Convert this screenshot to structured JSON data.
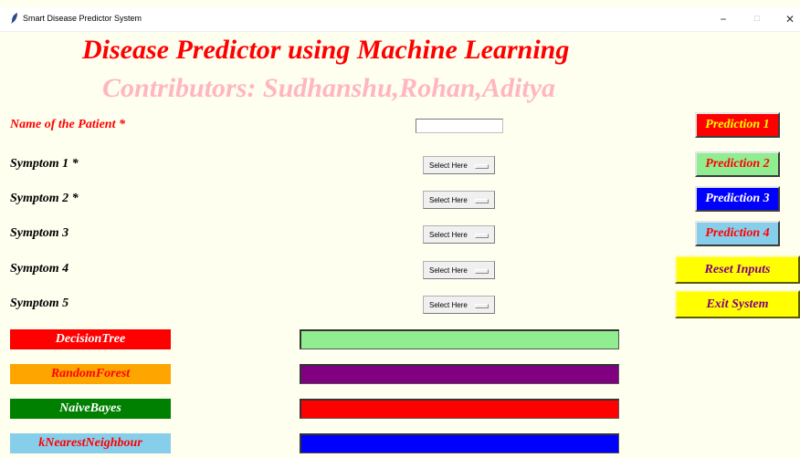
{
  "window": {
    "title": "Smart Disease Predictor System",
    "controls": {
      "minimize": "−",
      "maximize": "□",
      "close": "✕"
    }
  },
  "header": {
    "title": "Disease Predictor using Machine Learning",
    "subtitle": "Contributors: Sudhanshu,Rohan,Aditya"
  },
  "form": {
    "name_label": "Name of the Patient *",
    "name_value": "",
    "symptoms": [
      {
        "label": "Symptom 1 *",
        "selected": "Select Here"
      },
      {
        "label": "Symptom 2 *",
        "selected": "Select Here"
      },
      {
        "label": "Symptom 3",
        "selected": "Select Here"
      },
      {
        "label": "Symptom 4",
        "selected": "Select Here"
      },
      {
        "label": "Symptom 5",
        "selected": "Select Here"
      }
    ]
  },
  "buttons": {
    "prediction_1": "Prediction 1",
    "prediction_2": "Prediction 2",
    "prediction_3": "Prediction 3",
    "prediction_4": "Prediction 4",
    "reset": "Reset Inputs",
    "exit": "Exit System"
  },
  "algorithms": [
    {
      "label": "DecisionTree",
      "label_bg": "#ff0000",
      "label_color": "#ffffff",
      "result": "",
      "result_bg": "#90ee90"
    },
    {
      "label": "RandomForest",
      "label_bg": "#ffa500",
      "label_color": "#ff0000",
      "result": "",
      "result_bg": "#800080"
    },
    {
      "label": "NaiveBayes",
      "label_bg": "#008000",
      "label_color": "#ffffff",
      "result": "",
      "result_bg": "#ff0000"
    },
    {
      "label": "kNearestNeighbour",
      "label_bg": "#87ceeb",
      "label_color": "#ff0000",
      "result": "",
      "result_bg": "#0000ff"
    }
  ],
  "colors": {
    "background": "#fffff0",
    "title": "#ff0000",
    "subtitle": "#ffb6c1",
    "prediction_1": {
      "bg": "#ff0000",
      "fg": "#ffff00"
    },
    "prediction_2": {
      "bg": "#90ee90",
      "fg": "#ff0000"
    },
    "prediction_3": {
      "bg": "#0000ff",
      "fg": "#ffffff"
    },
    "prediction_4": {
      "bg": "#87ceeb",
      "fg": "#ff0000"
    },
    "reset": {
      "bg": "#ffff00",
      "fg": "#800080"
    },
    "exit": {
      "bg": "#ffff00",
      "fg": "#800080"
    }
  },
  "icons": {
    "app": "feather-icon",
    "select_indicator": "option-menu-indicator-icon"
  }
}
